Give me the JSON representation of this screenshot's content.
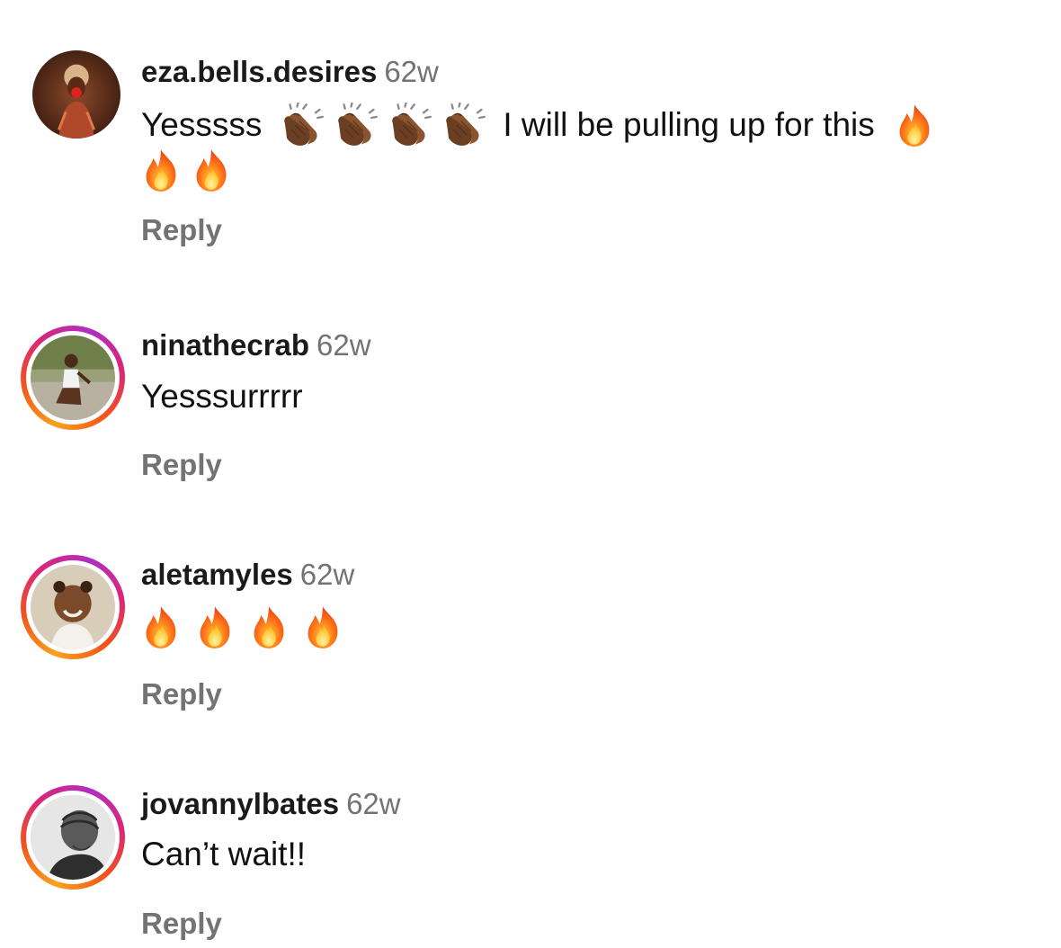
{
  "comments": [
    {
      "username": "eza.bells.desires",
      "time": "62w",
      "text_part1": "Yesssss",
      "text_part2": "I will be pulling up for this",
      "reply_label": "Reply",
      "has_story": false,
      "emoji": [
        "clapping-hands",
        "clapping-hands",
        "clapping-hands",
        "clapping-hands",
        "fire",
        "fire",
        "fire"
      ]
    },
    {
      "username": "ninathecrab",
      "time": "62w",
      "text": "Yesssurrrrr",
      "reply_label": "Reply",
      "has_story": true
    },
    {
      "username": "aletamyles",
      "time": "62w",
      "reply_label": "Reply",
      "has_story": true,
      "emoji": [
        "fire",
        "fire",
        "fire",
        "fire"
      ]
    },
    {
      "username": "jovannylbates",
      "time": "62w",
      "text": "Can’t wait!!",
      "reply_label": "Reply",
      "has_story": true
    }
  ],
  "colors": {
    "username": "#1a1a1a",
    "timestamp": "#737373",
    "reply": "#737373",
    "story_ring_start": "#f9a21c",
    "story_ring_end": "#b02fc2"
  }
}
